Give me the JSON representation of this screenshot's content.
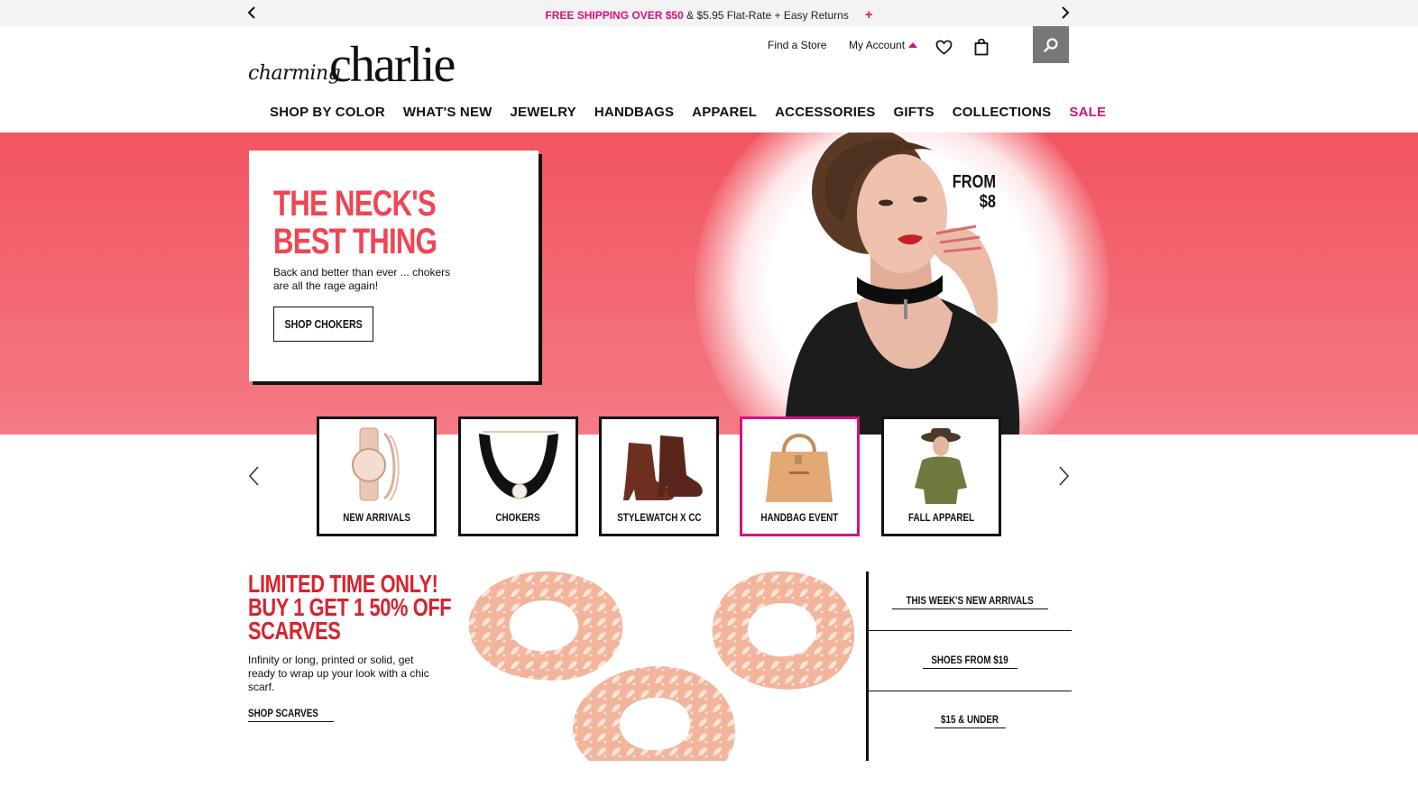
{
  "promo_bar": {
    "highlight": "FREE SHIPPING OVER $50",
    "rest": " & $5.95 Flat-Rate + Easy Returns",
    "plus": "+"
  },
  "header": {
    "logo_script": "charming",
    "logo_word": "charlie",
    "find_store": "Find a Store",
    "my_account": "My Account",
    "icons": [
      "heart-icon",
      "shopping-bag-icon",
      "search-icon"
    ]
  },
  "nav": {
    "items": [
      "SHOP BY COLOR",
      "WHAT'S NEW",
      "JEWELRY",
      "HANDBAGS",
      "APPAREL",
      "ACCESSORIES",
      "GIFTS",
      "COLLECTIONS",
      "SALE"
    ]
  },
  "hero": {
    "title_line1": "THE NECK'S",
    "title_line2": "BEST THING",
    "description": "Back and better than ever ... chokers are all the rage again!",
    "button": "SHOP CHOKERS",
    "price_line1": "FROM",
    "price_line2": "$8",
    "colors": {
      "accent": "#ee4654",
      "background": "#f2545f"
    }
  },
  "categories": {
    "tiles": [
      {
        "label": "NEW ARRIVALS",
        "icon": "watch-icon"
      },
      {
        "label": "CHOKERS",
        "icon": "choker-icon"
      },
      {
        "label": "STYLEWATCH X CC",
        "icon": "boot-icon"
      },
      {
        "label": "HANDBAG EVENT",
        "icon": "handbag-icon",
        "active": true
      },
      {
        "label": "FALL APPAREL",
        "icon": "apparel-icon"
      }
    ]
  },
  "bottom_promo": {
    "title_line1": "LIMITED TIME ONLY!",
    "title_line2": "BUY 1 GET 1 50% OFF",
    "title_line3": "SCARVES",
    "description": "Infinity or long, printed or solid, get ready to wrap up your look with a chic scarf.",
    "link": "SHOP SCARVES"
  },
  "side_links": [
    "THIS WEEK'S NEW ARRIVALS",
    "SHOES FROM $19",
    "$15 & UNDER"
  ],
  "brand_colors": {
    "pink": "#d4127f",
    "red": "#d8232e"
  }
}
